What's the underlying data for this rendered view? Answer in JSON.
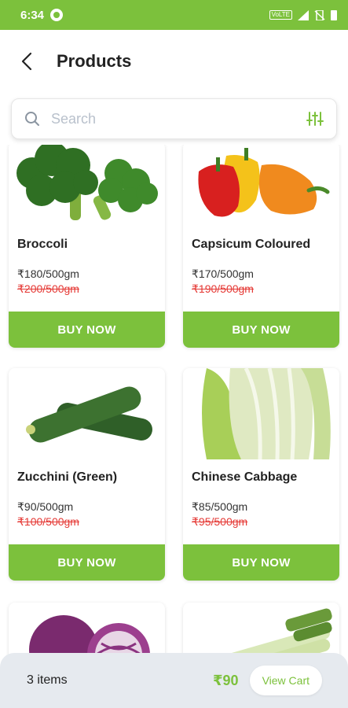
{
  "status_bar": {
    "time": "6:34",
    "network": "VoLTE"
  },
  "header": {
    "title": "Products"
  },
  "search": {
    "placeholder": "Search",
    "value": ""
  },
  "products": [
    {
      "name": "Broccoli",
      "price": "₹180/500gm",
      "old_price": "₹200/500gm",
      "button": "BUY NOW",
      "image": "broccoli"
    },
    {
      "name": "Capsicum Coloured",
      "price": "₹170/500gm",
      "old_price": "₹190/500gm",
      "button": "BUY NOW",
      "image": "capsicum"
    },
    {
      "name": "Zucchini (Green)",
      "price": "₹90/500gm",
      "old_price": "₹100/500gm",
      "button": "BUY NOW",
      "image": "zucchini"
    },
    {
      "name": "Chinese Cabbage",
      "price": "₹85/500gm",
      "old_price": "₹95/500gm",
      "button": "BUY NOW",
      "image": "chinese-cabbage"
    },
    {
      "name": "",
      "price": "",
      "old_price": "",
      "button": "",
      "image": "red-cabbage"
    },
    {
      "name": "",
      "price": "",
      "old_price": "",
      "button": "",
      "image": "leek"
    }
  ],
  "cart": {
    "items": "3 items",
    "total": "₹90",
    "button": "View Cart"
  },
  "colors": {
    "brand": "#7cc13c",
    "strike_price": "#e53935",
    "cart_bar": "#e6eaef"
  }
}
